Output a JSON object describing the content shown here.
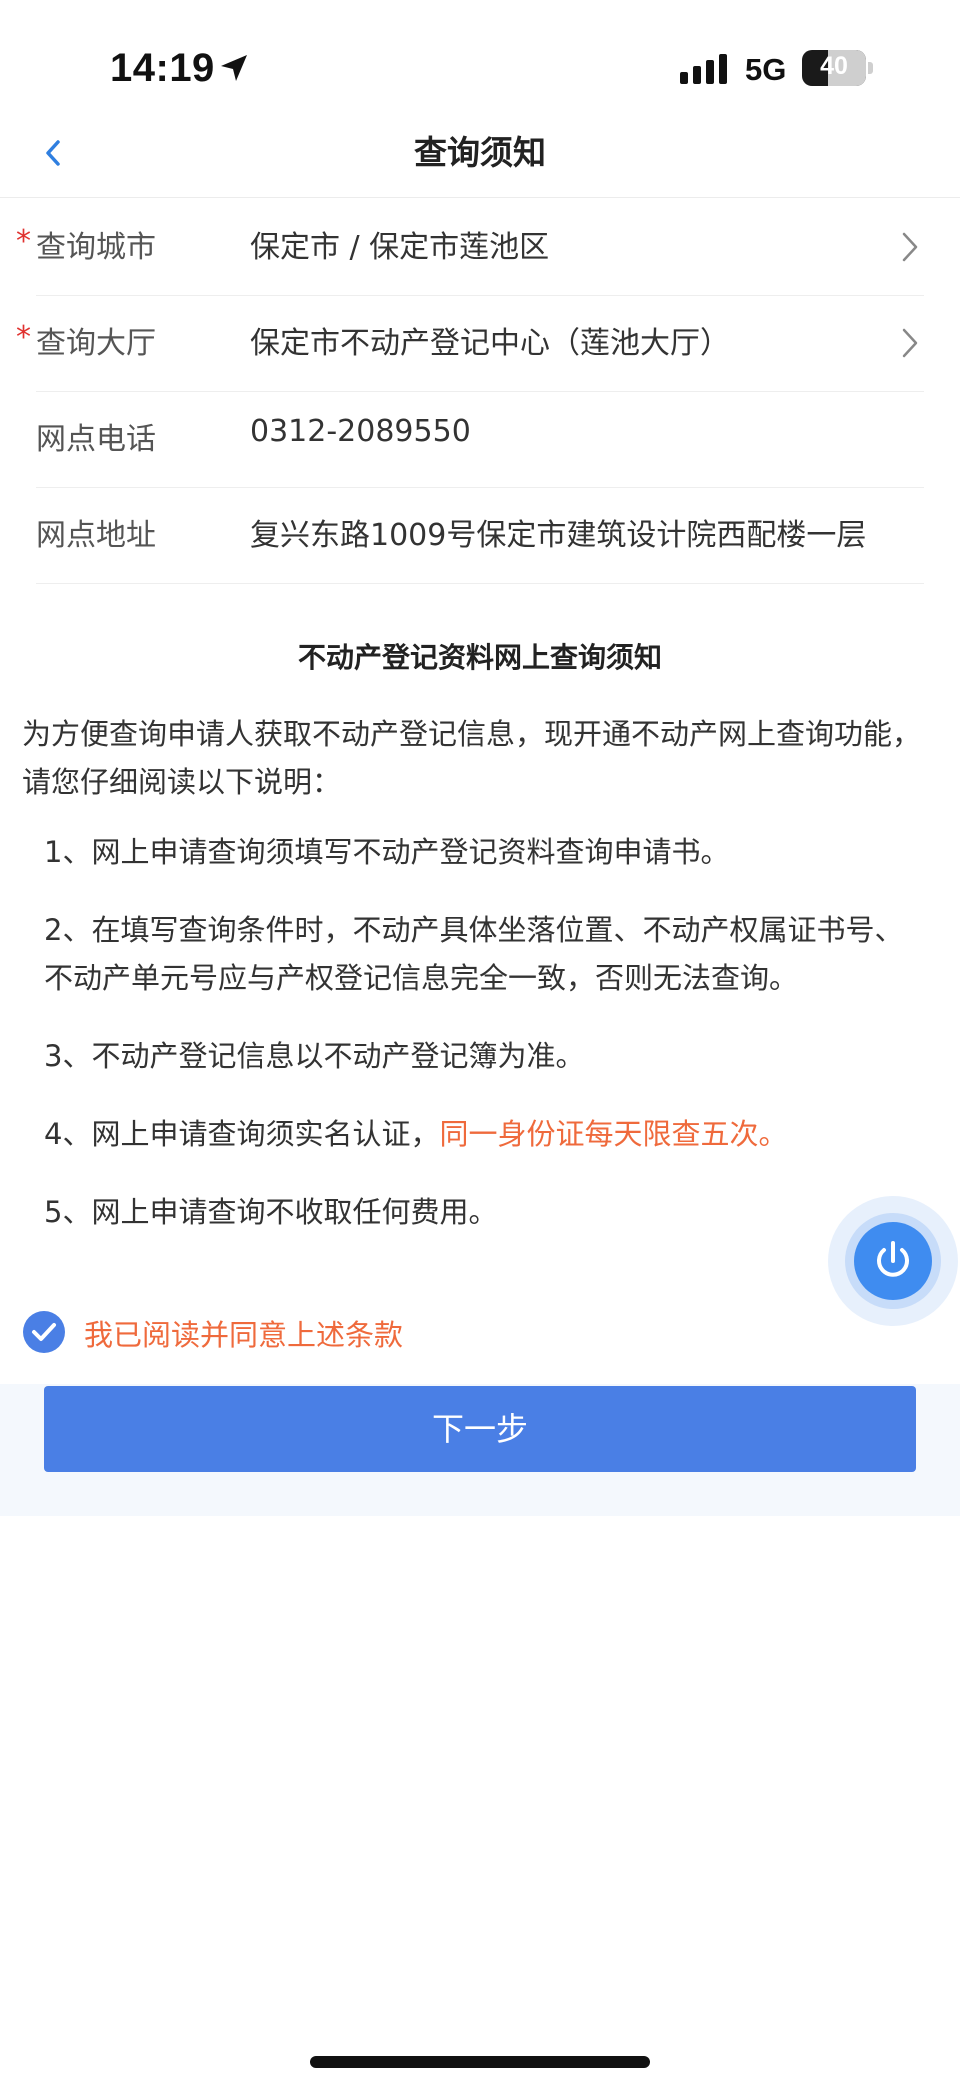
{
  "status_bar": {
    "time": "14:19",
    "network": "5G",
    "battery": "40",
    "icons": [
      "location-arrow-icon",
      "signal-bars-icon",
      "battery-icon"
    ]
  },
  "nav": {
    "title": "查询须知",
    "back_icon": "chevron-left-icon"
  },
  "form": {
    "rows": [
      {
        "required": true,
        "required_mark": "*",
        "label": "查询城市",
        "value": "保定市 / 保定市莲池区",
        "has_chevron": true
      },
      {
        "required": true,
        "required_mark": "*",
        "label": "查询大厅",
        "value": "保定市不动产登记中心（莲池大厅）",
        "has_chevron": true
      },
      {
        "required": false,
        "label": "网点电话",
        "value": "0312-2089550",
        "has_chevron": false
      },
      {
        "required": false,
        "label": "网点地址",
        "value": "复兴东路1009号保定市建筑设计院西配楼一层",
        "has_chevron": false
      }
    ]
  },
  "notice": {
    "title": "不动产登记资料网上查询须知",
    "intro": "为方便查询申请人获取不动产登记信息，现开通不动产网上查询功能，请您仔细阅读以下说明：",
    "items": [
      {
        "text": "1、网上申请查询须填写不动产登记资料查询申请书。"
      },
      {
        "text": "2、在填写查询条件时，不动产具体坐落位置、不动产权属证书号、不动产单元号应与产权登记信息完全一致，否则无法查询。"
      },
      {
        "text": "3、不动产登记信息以不动产登记簿为准。"
      },
      {
        "text": "4、网上申请查询须实名认证，",
        "highlight": "同一身份证每天限查五次。"
      },
      {
        "text": "5、网上申请查询不收取任何费用。"
      }
    ]
  },
  "agreement": {
    "checked": true,
    "label": "我已阅读并同意上述条款"
  },
  "next_button": {
    "label": "下一步"
  },
  "floating_button": {
    "icon": "power-icon"
  },
  "colors": {
    "primary": "#4a7fe5",
    "float_blue": "#3f8cf0",
    "highlight": "#ef6a3c",
    "required": "#e0322f",
    "back_icon": "#2f7fe0"
  }
}
